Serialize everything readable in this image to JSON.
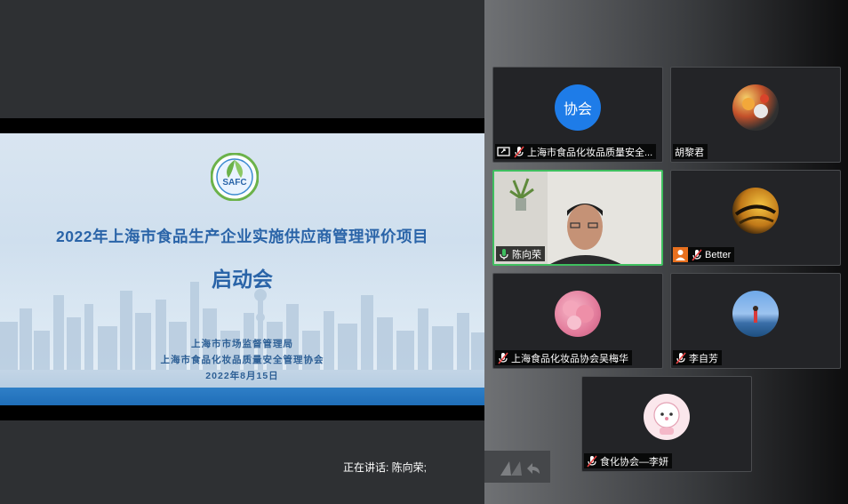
{
  "slide": {
    "logo_text": "SAFC",
    "title": "2022年上海市食品生产企业实施供应商管理评价项目",
    "subtitle": "启动会",
    "org1": "上海市市场监督管理局",
    "org2": "上海市食品化妆品质量安全管理协会",
    "date": "2022年8月15日"
  },
  "status": {
    "speaking": "正在讲话: 陈向荣;"
  },
  "participants": [
    {
      "name": "上海市食品化妆品质量安全...",
      "avatar_text": "协会",
      "avatar_color": "#1e7ce8",
      "muted": true,
      "sharing": true
    },
    {
      "name": "胡黎君",
      "muted": false
    },
    {
      "name": "陈向荣",
      "muted": false,
      "active": true
    },
    {
      "name": "Better",
      "muted": true,
      "avatar_color": "#e8701e"
    },
    {
      "name": "上海食品化妆品协会吴梅华",
      "muted": true
    },
    {
      "name": "李自芳",
      "muted": true
    },
    {
      "name": "食化协会—李妍",
      "muted": true
    }
  ],
  "colors": {
    "active_border": "#3fbf5f",
    "slide_title": "#2a64a8",
    "slide_bottom_bar": "#2f7fc7"
  }
}
